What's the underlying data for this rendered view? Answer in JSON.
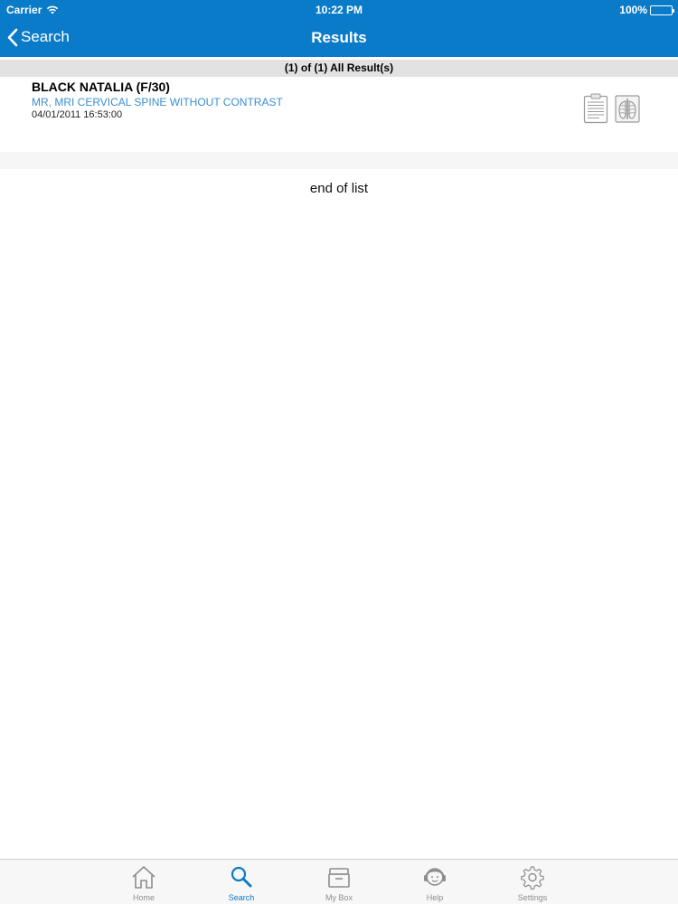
{
  "status_bar": {
    "carrier": "Carrier",
    "time": "10:22 PM",
    "battery": "100%"
  },
  "nav": {
    "back_label": "Search",
    "title": "Results"
  },
  "results_header": "(1) of (1) All Result(s)",
  "results": [
    {
      "patient_name": "BLACK NATALIA (F/30)",
      "study": "MR, MRI CERVICAL SPINE WITHOUT CONTRAST",
      "datetime": "04/01/2011 16:53:00",
      "icons": [
        "report-icon",
        "xray-icon"
      ]
    }
  ],
  "end_of_list": "end of list",
  "tabs": [
    {
      "label": "Home",
      "icon": "home-icon"
    },
    {
      "label": "Search",
      "icon": "search-icon",
      "active": true
    },
    {
      "label": "My Box",
      "icon": "box-icon"
    },
    {
      "label": "Help",
      "icon": "help-icon"
    },
    {
      "label": "Settings",
      "icon": "gear-icon"
    }
  ],
  "colors": {
    "brand": "#0a7bc8",
    "study_text": "#3a8fcf",
    "tab_inactive": "#8e8e8e"
  }
}
